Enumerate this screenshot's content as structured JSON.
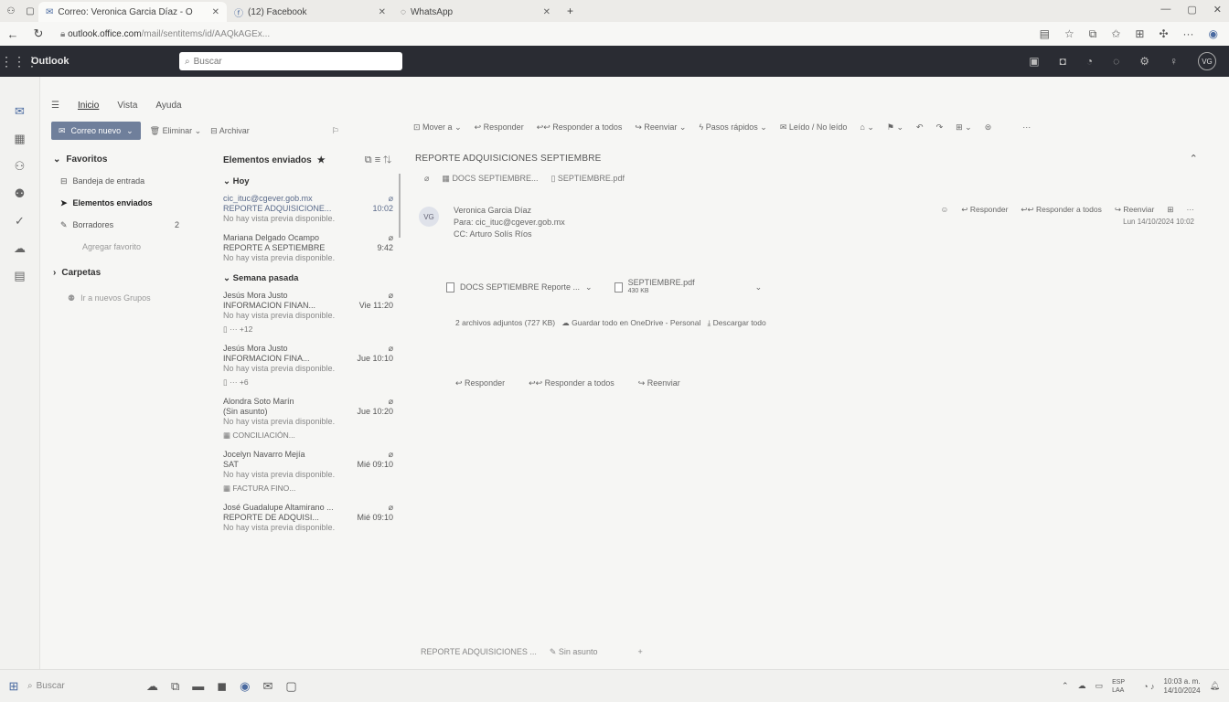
{
  "browser": {
    "tabs": [
      {
        "title": "Correo: Veronica Garcia Díaz - O",
        "close": "✕"
      },
      {
        "title": "(12) Facebook",
        "close": "✕"
      },
      {
        "title": "WhatsApp",
        "close": "✕"
      }
    ],
    "new_tab": "+",
    "url_domain": "outlook.office.com",
    "url_rest": "/mail/sentitems/id/AAQkAGEx..."
  },
  "app": {
    "name": "Outlook",
    "search_placeholder": "Buscar",
    "user_initials": "VG"
  },
  "ribbon": {
    "tabs": [
      "Inicio",
      "Vista",
      "Ayuda"
    ],
    "new_mail": "Correo nuevo",
    "delete": "Eliminar",
    "archive": "Archivar",
    "actions": [
      "Mover a",
      "Responder",
      "Responder a todos",
      "Reenviar",
      "Pasos rápidos",
      "Leído / No leído"
    ],
    "more": "···"
  },
  "folders": {
    "favorites_label": "Favoritos",
    "items": [
      {
        "label": "Bandeja de entrada",
        "count": ""
      },
      {
        "label": "Elementos enviados",
        "count": ""
      },
      {
        "label": "Borradores",
        "count": "2"
      },
      {
        "label": "Agregar favorito",
        "count": ""
      }
    ],
    "folders_label": "Carpetas",
    "groups_label": "Ir a nuevos Grupos"
  },
  "message_list": {
    "header": "Elementos enviados",
    "group_today": "Hoy",
    "group_last_week": "Semana pasada",
    "messages": [
      {
        "from": "cic_ituc@cgever.gob.mx",
        "subject": "REPORTE ADQUISICIONE...",
        "time": "10:02",
        "preview": "No hay vista previa disponible.",
        "attachment": ""
      },
      {
        "from": "Mariana Delgado Ocampo",
        "subject": "REPORTE A SEPTIEMBRE",
        "time": "9:42",
        "preview": "No hay vista previa disponible.",
        "attachment": ""
      },
      {
        "from": "Jesús Mora Justo",
        "subject": "INFORMACION FINAN...",
        "time": "Vie 11:20",
        "preview": "No hay vista previa disponible.",
        "attachment": "+12"
      },
      {
        "from": "Jesús Mora Justo",
        "subject": "INFORMACION FINA...",
        "time": "Jue 10:10",
        "preview": "No hay vista previa disponible.",
        "attachment": "+6"
      },
      {
        "from": "Alondra Soto Marín",
        "subject": "(Sin asunto)",
        "time": "Jue 10:20",
        "preview": "No hay vista previa disponible.",
        "attachment": "CONCILIACIÓN..."
      },
      {
        "from": "Jocelyn Navarro Mejía",
        "subject": "SAT",
        "time": "Mié 09:10",
        "preview": "No hay vista previa disponible.",
        "attachment": "FACTURA FINO..."
      },
      {
        "from": "José Guadalupe Altamirano ...",
        "subject": "REPORTE DE ADQUISI...",
        "time": "Mié 09:10",
        "preview": "No hay vista previa disponible.",
        "attachment": ""
      }
    ]
  },
  "reading": {
    "subject": "REPORTE ADQUISICIONES SEPTIEMBRE",
    "attachments_top": [
      "DOCS SEPTIEMBRE...",
      "SEPTIEMBRE.pdf"
    ],
    "sender_name": "Veronica Garcia Díaz",
    "sender_initials": "VG",
    "to": "Para: cic_ituc@cgever.gob.mx",
    "cc": "CC: Arturo Solís Ríos",
    "date": "Lun 14/10/2024 10:02",
    "header_actions": [
      "Responder",
      "Responder a todos",
      "Reenviar"
    ],
    "attachment_cards": [
      {
        "name": "DOCS SEPTIEMBRE Reporte ...",
        "size": ""
      },
      {
        "name": "SEPTIEMBRE.pdf",
        "size": "430 KB"
      }
    ],
    "attachment_summary": "2 archivos adjuntos (727 KB)",
    "save_onedrive": "Guardar todo en OneDrive - Personal",
    "download_all": "Descargar todo",
    "bottom_actions": [
      "Responder",
      "Responder a todos",
      "Reenviar"
    ]
  },
  "draft_bar": {
    "label": "REPORTE ADQUISICIONES ...",
    "status": "Sin asunto"
  },
  "taskbar": {
    "search": "Buscar",
    "lang": "ESP LAA",
    "time": "10:03 a. m.",
    "date": "14/10/2024"
  }
}
